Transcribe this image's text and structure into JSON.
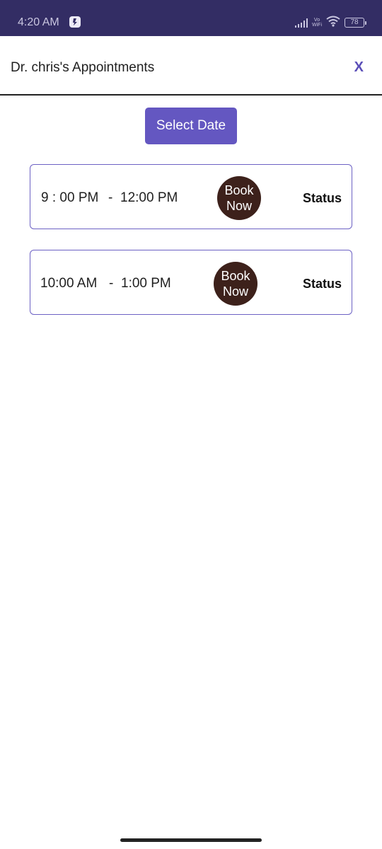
{
  "status_bar": {
    "time": "4:20 AM",
    "app_icon": "notification-app-icon",
    "vowifi": [
      "Vo",
      "WiFi"
    ],
    "battery": "78",
    "colors": {
      "background": "#332d64"
    }
  },
  "header": {
    "title": "Dr. chris's Appointments",
    "close_label": "X"
  },
  "select_date": {
    "label": "Select Date",
    "color": "#6457c1"
  },
  "slots": [
    {
      "start": "9 : 00 PM",
      "separator": "-",
      "end": "12:00 PM",
      "book_label_1": "Book",
      "book_label_2": "Now",
      "status": "Status"
    },
    {
      "start": "10:00 AM",
      "separator": "-",
      "end": "1:00 PM",
      "book_label_1": "Book",
      "book_label_2": "Now",
      "status": "Status"
    }
  ],
  "colors": {
    "accent": "#6457c1",
    "book_button": "#3d211b",
    "card_border": "#6c61c4"
  }
}
